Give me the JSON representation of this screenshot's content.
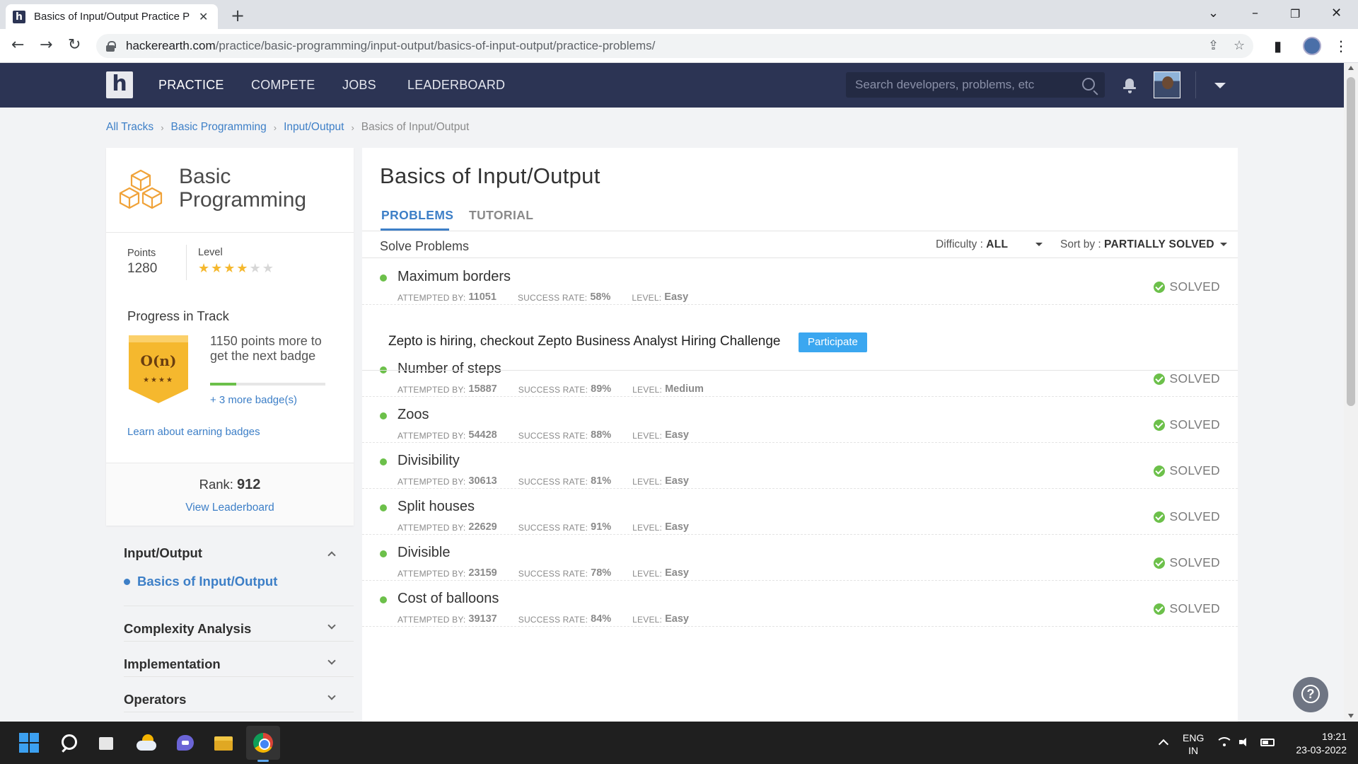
{
  "browser": {
    "tab_title": "Basics of Input/Output Practice P",
    "url_domain": "hackerearth.com",
    "url_path": "/practice/basic-programming/input-output/basics-of-input-output/practice-problems/"
  },
  "site_nav": {
    "logo": "h",
    "items": [
      "PRACTICE",
      "COMPETE",
      "JOBS",
      "LEADERBOARD"
    ],
    "active_item": "PRACTICE",
    "search_placeholder": "Search developers, problems, etc"
  },
  "breadcrumb": {
    "links": [
      "All Tracks",
      "Basic Programming",
      "Input/Output"
    ],
    "current": "Basics of Input/Output"
  },
  "track": {
    "title_line1": "Basic",
    "title_line2": "Programming",
    "points_label": "Points",
    "points": "1280",
    "level_label": "Level",
    "level_stars": 4,
    "level_stars_max": 6,
    "progress_title": "Progress in Track",
    "badge_text": "O(n)",
    "badge_stars": "★★★★",
    "points_more": "1150 points more to get the next badge",
    "next_badge_progress": 0.23,
    "more_badges": "+ 3 more badge(s)",
    "learn_link": "Learn about earning badges",
    "rank_label": "Rank:",
    "rank": "912",
    "view_leaderboard": "View Leaderboard"
  },
  "track_nav": {
    "open_section": "Input/Output",
    "open_subitem": "Basics of Input/Output",
    "sections": [
      "Complexity Analysis",
      "Implementation",
      "Operators"
    ]
  },
  "main": {
    "title": "Basics of Input/Output",
    "tabs": [
      "PROBLEMS",
      "TUTORIAL"
    ],
    "solve_label": "Solve Problems",
    "difficulty_label": "Difficulty :",
    "difficulty_value": "ALL",
    "sort_label": "Sort by :",
    "sort_value": "PARTIALLY SOLVED",
    "meta_labels": {
      "attempted": "ATTEMPTED BY:",
      "success": "SUCCESS RATE:",
      "level": "LEVEL:"
    },
    "status_label": "SOLVED",
    "promo_text": "Zepto is hiring, checkout Zepto Business Analyst Hiring Challenge",
    "promo_button": "Participate",
    "problems": [
      {
        "name": "Maximum borders",
        "attempted": "11051",
        "success": "58%",
        "level": "Easy"
      },
      {
        "name": "Number of steps",
        "attempted": "15887",
        "success": "89%",
        "level": "Medium"
      },
      {
        "name": "Zoos",
        "attempted": "54428",
        "success": "88%",
        "level": "Easy"
      },
      {
        "name": "Divisibility",
        "attempted": "30613",
        "success": "81%",
        "level": "Easy"
      },
      {
        "name": "Split houses",
        "attempted": "22629",
        "success": "91%",
        "level": "Easy"
      },
      {
        "name": "Divisible",
        "attempted": "23159",
        "success": "78%",
        "level": "Easy"
      },
      {
        "name": "Cost of balloons",
        "attempted": "39137",
        "success": "84%",
        "level": "Easy"
      }
    ]
  },
  "taskbar": {
    "lang_line1": "ENG",
    "lang_line2": "IN",
    "time": "19:21",
    "date": "23-03-2022"
  },
  "colors": {
    "header_bg": "#2c3454",
    "link_blue": "#3d7fc7",
    "success_green": "#6cc04a",
    "star_gold": "#f5b82e",
    "participate_blue": "#3ba7f0"
  }
}
